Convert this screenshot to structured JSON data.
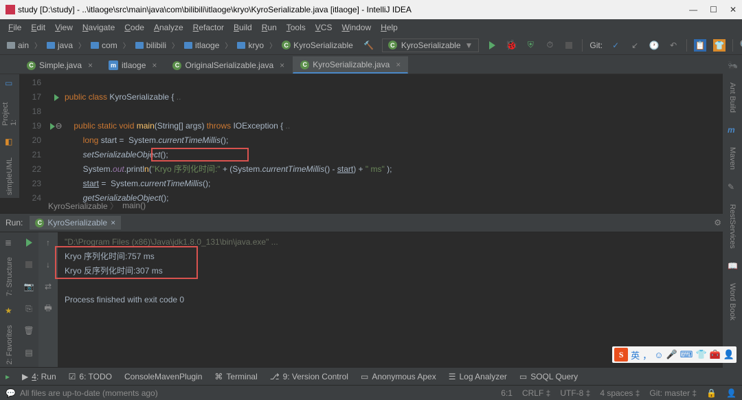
{
  "window": {
    "title": "study [D:\\study] - ..\\itlaoge\\src\\main\\java\\com\\bilibili\\itlaoge\\kryo\\KyroSerializable.java [itlaoge] - IntelliJ IDEA",
    "controls": {
      "min": "—",
      "max": "☐",
      "close": "✕"
    }
  },
  "menu": [
    "File",
    "Edit",
    "View",
    "Navigate",
    "Code",
    "Analyze",
    "Refactor",
    "Build",
    "Run",
    "Tools",
    "VCS",
    "Window",
    "Help"
  ],
  "breadcrumbs": [
    "ain",
    "java",
    "com",
    "bilibili",
    "itlaoge",
    "kryo",
    "KyroSerializable"
  ],
  "runconfig": "KyroSerializable",
  "git_label": "Git:",
  "tabs": [
    {
      "label": "Simple.java",
      "active": false,
      "icon": "c"
    },
    {
      "label": "itlaoge",
      "active": false,
      "icon": "m"
    },
    {
      "label": "OriginalSerializable.java",
      "active": false,
      "icon": "c"
    },
    {
      "label": "KyroSerializable.java",
      "active": true,
      "icon": "c"
    }
  ],
  "code": {
    "lines": [
      {
        "n": 16,
        "html": ""
      },
      {
        "n": 17,
        "mark": "play",
        "html": "<span class='kw'>public class</span> <span>KyroSerializable</span> {<span class='comment-dots'> ..</span>"
      },
      {
        "n": 18,
        "html": ""
      },
      {
        "n": 19,
        "mark": "play",
        "fold": true,
        "html": "    <span class='kw'>public static void</span> <span class='fn'>main</span>(String[] args) <span class='kw'>throws</span> IOException {<span class='comment-dots'> ..</span>"
      },
      {
        "n": 20,
        "html": "        <span class='kw'>long</span> start =  System.<span class='meth-i'>currentTimeMillis</span>();"
      },
      {
        "n": 21,
        "html": "        <span class='meth-i'>setSerializableObject</span>();"
      },
      {
        "n": 22,
        "html": "        System.<span class='field'>out</span>.printl<span class='fn'>n</span>(<span class='str'>\"Kryo 序列化时间:\"</span> + (System.<span class='meth-i'>currentTimeMillis</span>() - <span class='underline'>start</span>) + <span class='str'>\" ms\"</span> );"
      },
      {
        "n": 23,
        "html": "        <span class='underline'>start</span> =  System.<span class='meth-i'>currentTimeMillis</span>();"
      },
      {
        "n": 24,
        "html": "        <span class='meth-i'>getSerializableObject</span>();"
      }
    ]
  },
  "editor_crumbs": [
    "KyroSerializable",
    "main()"
  ],
  "run_tab_label": "Run:",
  "run_tab": "KyroSerializable",
  "console": {
    "cmd": "\"D:\\Program Files (x86)\\Java\\jdk1.8.0_131\\bin\\java.exe\" ...",
    "out1": "Kryo 序列化时间:757 ms",
    "out2": "Kryo 反序列化时间:307 ms",
    "exit": "Process finished with exit code 0"
  },
  "bottom": [
    {
      "label": "4: Run",
      "u": true
    },
    {
      "label": "6: TODO"
    },
    {
      "label": "ConsoleMavenPlugin"
    },
    {
      "label": "Terminal"
    },
    {
      "label": "9: Version Control"
    },
    {
      "label": "Anonymous Apex"
    },
    {
      "label": "Log Analyzer"
    },
    {
      "label": "SOQL Query"
    }
  ],
  "status": {
    "msg": "All files are up-to-date (moments ago)",
    "pos": "6:1",
    "eol": "CRLF",
    "enc": "UTF-8",
    "indent": "4 spaces",
    "git": "Git: master"
  },
  "left_tools": [
    "1: Project",
    "simpleUML"
  ],
  "left_tools2": [
    "7: Structure",
    "2: Favorites"
  ],
  "right_tools": [
    "Ant Build",
    "Maven",
    "RestServices",
    "Word Book"
  ],
  "ime": {
    "s": "S",
    "lang": "英"
  }
}
